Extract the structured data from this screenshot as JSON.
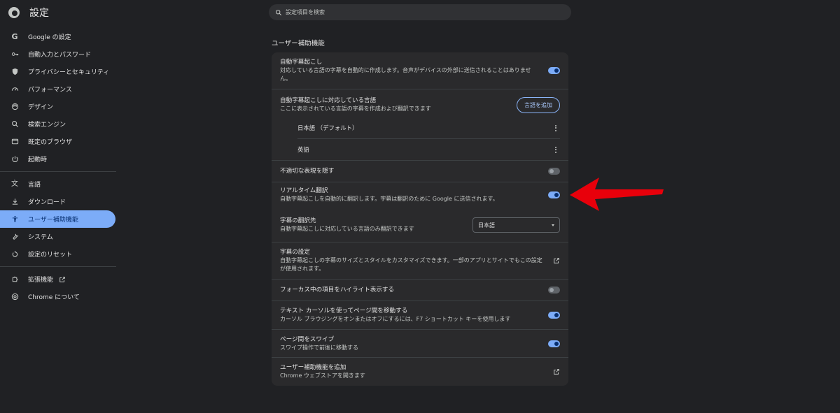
{
  "app": {
    "title": "設定"
  },
  "search": {
    "placeholder": "設定項目を検索"
  },
  "sidebar": {
    "items": [
      {
        "label": "Google の設定",
        "icon": "google-icon"
      },
      {
        "label": "自動入力とパスワード",
        "icon": "key-icon"
      },
      {
        "label": "プライバシーとセキュリティ",
        "icon": "shield-icon"
      },
      {
        "label": "パフォーマンス",
        "icon": "speedometer-icon"
      },
      {
        "label": "デザイン",
        "icon": "palette-icon"
      },
      {
        "label": "検索エンジン",
        "icon": "search-icon"
      },
      {
        "label": "既定のブラウザ",
        "icon": "browser-window-icon"
      },
      {
        "label": "起動時",
        "icon": "power-icon"
      },
      {
        "label": "言語",
        "icon": "translate-icon"
      },
      {
        "label": "ダウンロード",
        "icon": "download-icon"
      },
      {
        "label": "ユーザー補助機能",
        "icon": "accessibility-icon",
        "active": true
      },
      {
        "label": "システム",
        "icon": "wrench-icon"
      },
      {
        "label": "設定のリセット",
        "icon": "reset-icon"
      },
      {
        "label": "拡張機能",
        "icon": "puzzle-icon"
      },
      {
        "label": "Chrome について",
        "icon": "chrome-icon"
      }
    ]
  },
  "main": {
    "section_title": "ユーザー補助機能",
    "live_caption": {
      "title": "自動字幕起こし",
      "desc": "対応している言語の字幕を自動的に作成します。音声がデバイスの外部に送信されることはありません。",
      "enabled": true
    },
    "caption_languages": {
      "title": "自動字幕起こしに対応している言語",
      "desc": "ここに表示されている言語の字幕を作成および翻訳できます",
      "add_button": "言語を追加",
      "languages": [
        "日本語 （デフォルト）",
        "英語"
      ]
    },
    "mask_offensive": {
      "title": "不適切な表現を隠す",
      "enabled": false
    },
    "live_translate": {
      "title": "リアルタイム翻訳",
      "desc": "自動字幕起こしを自動的に翻訳します。字幕は翻訳のために Google に送信されます。",
      "enabled": true
    },
    "translate_target": {
      "title": "字幕の翻訳先",
      "desc": "自動字幕起こしに対応している言語のみ翻訳できます",
      "selected": "日本語"
    },
    "caption_settings": {
      "title": "字幕の設定",
      "desc": "自動字幕起こしの字幕のサイズとスタイルをカスタマイズできます。一部のアプリとサイトでもこの設定が使用されます。"
    },
    "focus_highlight": {
      "title": "フォーカス中の項目をハイライト表示する",
      "enabled": false
    },
    "caret_browsing": {
      "title": "テキスト カーソルを使ってページ間を移動する",
      "desc": "カーソル ブラウジングをオンまたはオフにするには、F7 ショートカット キーを使用します",
      "enabled": true
    },
    "swipe_nav": {
      "title": "ページ間をスワイプ",
      "desc": "スワイプ操作で前後に移動する",
      "enabled": true
    },
    "add_accessibility": {
      "title": "ユーザー補助機能を追加",
      "desc": "Chrome ウェブストアを開きます"
    }
  },
  "colors": {
    "background": "#202124",
    "card": "#2a2a2c",
    "accent": "#7cacf8",
    "annotation_arrow": "#e8000b"
  }
}
